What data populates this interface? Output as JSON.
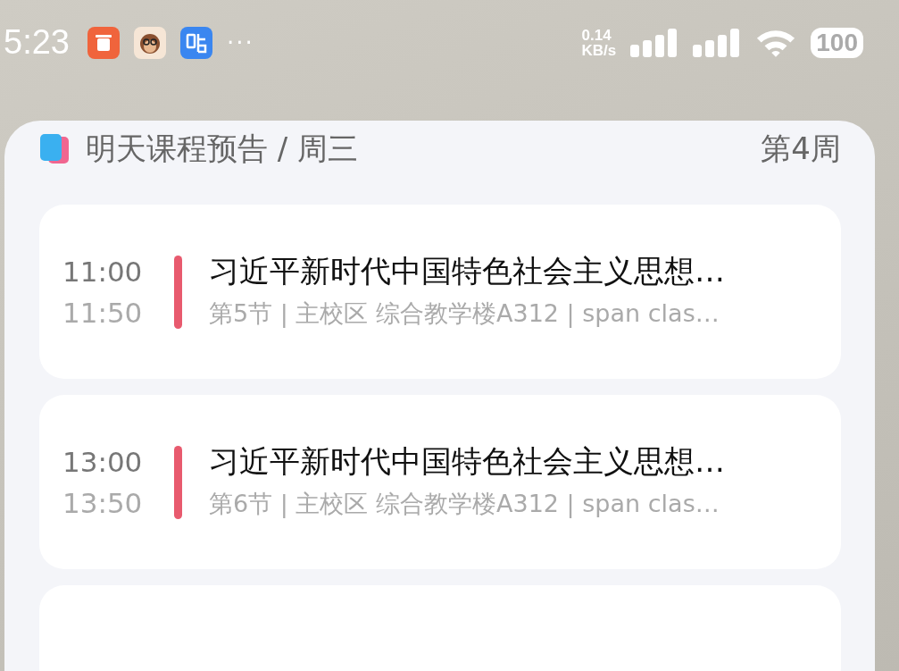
{
  "status_bar": {
    "time": "5:23",
    "more": "···",
    "net_speed": "0.14",
    "net_unit": "KB/s",
    "battery": "100"
  },
  "widget": {
    "title": "明天课程预告 / 周三",
    "week": "第4周",
    "courses": [
      {
        "start": "11:00",
        "end": "11:50",
        "name": "习近平新时代中国特色社会主义思想…",
        "detail": "第5节 | 主校区  综合教学楼A312 | span clas…"
      },
      {
        "start": "13:00",
        "end": "13:50",
        "name": "习近平新时代中国特色社会主义思想…",
        "detail": "第6节 | 主校区  综合教学楼A312 | span clas…"
      }
    ]
  }
}
